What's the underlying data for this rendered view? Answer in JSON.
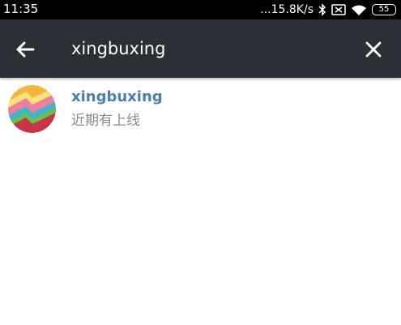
{
  "status_bar": {
    "time": "11:35",
    "network_speed": "...15.8K/s",
    "battery_level": "55",
    "icons": [
      "bluetooth-icon",
      "no-sim-icon",
      "wifi-icon",
      "battery-icon"
    ]
  },
  "toolbar": {
    "background_color": "#2b2f36",
    "search": {
      "value": "xingbuxing",
      "placeholder": ""
    },
    "back_icon": "arrow-left-icon",
    "clear_icon": "close-icon"
  },
  "results": [
    {
      "title": "xingbuxing",
      "subtitle": "近期有上线",
      "avatar": "rainbow-lightning-avatar"
    }
  ],
  "colors": {
    "title": "#4a7fae",
    "subtitle": "#8a8a8a"
  }
}
